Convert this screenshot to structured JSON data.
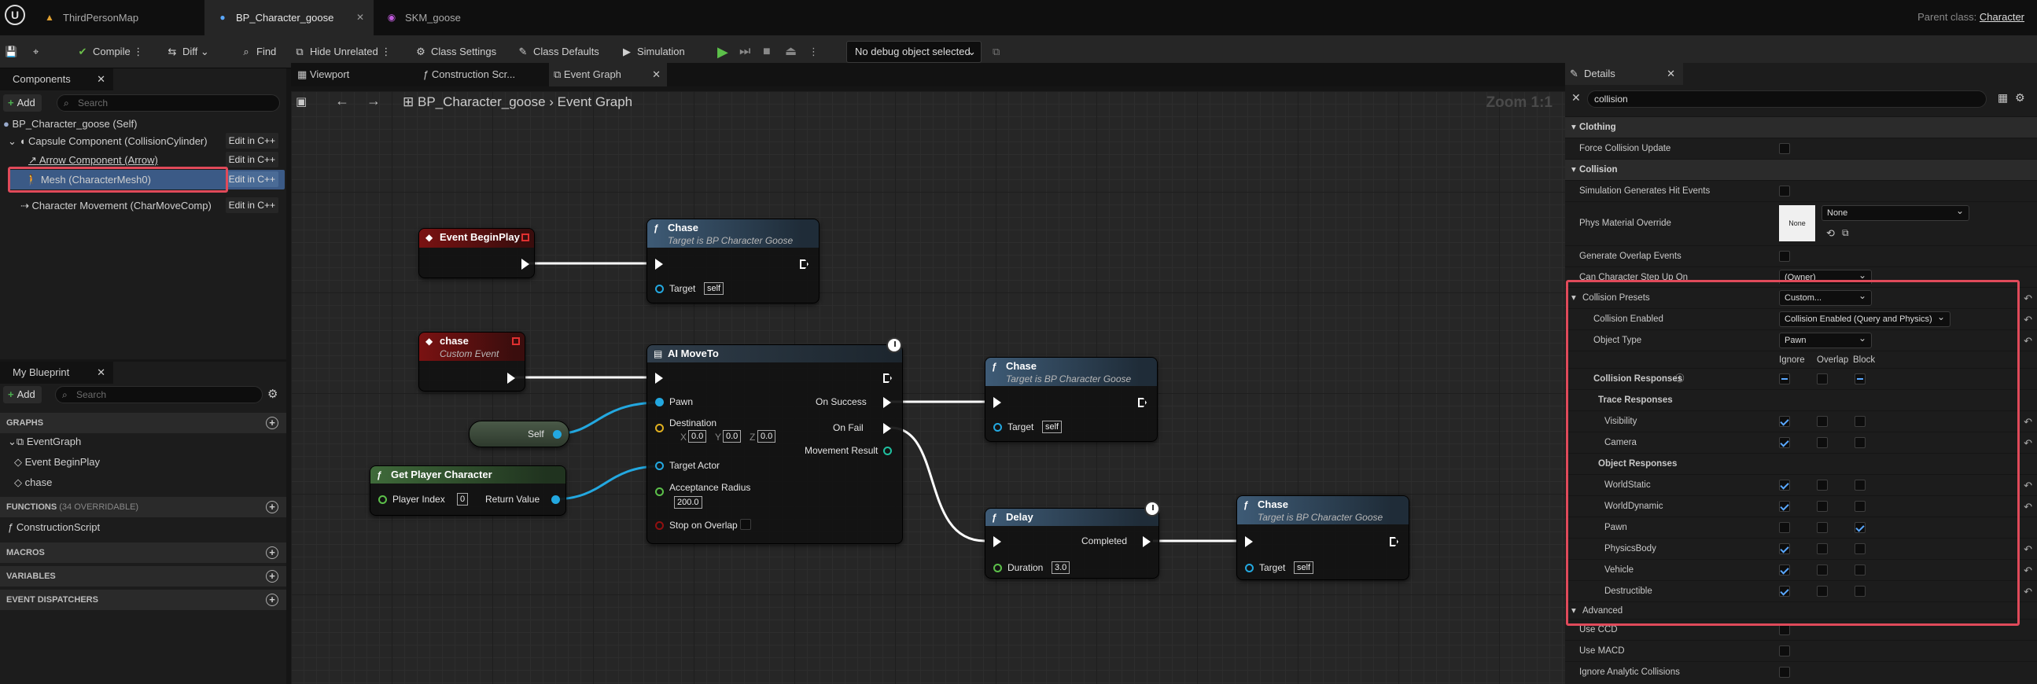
{
  "tabs": [
    {
      "label": "ThirdPersonMap"
    },
    {
      "label": "BP_Character_goose"
    },
    {
      "label": "SKM_goose"
    }
  ],
  "parent": {
    "label": "Parent class:",
    "value": "Character"
  },
  "toolbar": {
    "compile": "Compile",
    "diff": "Diff",
    "find": "Find",
    "hide_unrelated": "Hide Unrelated",
    "class_settings": "Class Settings",
    "class_defaults": "Class Defaults",
    "simulation": "Simulation",
    "debug": "No debug object selected"
  },
  "components": {
    "title": "Components",
    "add": "Add",
    "search": "Search",
    "items": [
      {
        "label": "BP_Character_goose (Self)"
      },
      {
        "label": "Capsule Component (CollisionCylinder)",
        "edit": "Edit in C++"
      },
      {
        "label": "Arrow Component (Arrow)",
        "edit": "Edit in C++"
      },
      {
        "label": "Mesh (CharacterMesh0)",
        "edit": "Edit in C++"
      },
      {
        "label": "Character Movement (CharMoveComp)",
        "edit": "Edit in C++"
      }
    ]
  },
  "myblueprint": {
    "title": "My Blueprint",
    "add": "Add",
    "search": "Search",
    "graphs": "GRAPHS",
    "graph_items": [
      "EventGraph",
      "Event BeginPlay",
      "chase"
    ],
    "functions": "FUNCTIONS",
    "functions_count": "(34 OVERRIDABLE)",
    "function_items": [
      "ConstructionScript"
    ],
    "macros": "MACROS",
    "variables": "VARIABLES",
    "dispatchers": "EVENT DISPATCHERS"
  },
  "graphtabs": [
    {
      "label": "Viewport"
    },
    {
      "label": "Construction Scr..."
    },
    {
      "label": "Event Graph"
    }
  ],
  "breadcrumb": {
    "root": "BP_Character_goose",
    "sep": "›",
    "page": "Event Graph",
    "zoom": "Zoom 1:1"
  },
  "nodes": {
    "beginplay": {
      "title": "Event BeginPlay"
    },
    "chase1": {
      "title": "Chase",
      "subtitle": "Target is BP Character Goose",
      "target": "Target",
      "self": "self"
    },
    "chaseevt": {
      "title": "chase",
      "subtitle": "Custom Event"
    },
    "self": {
      "label": "Self"
    },
    "gpc": {
      "title": "Get Player Character",
      "index_label": "Player Index",
      "index": "0",
      "ret": "Return Value"
    },
    "aimove": {
      "title": "AI MoveTo",
      "pawn": "Pawn",
      "dest": "Destination",
      "x": "0.0",
      "y": "0.0",
      "z": "0.0",
      "target_actor": "Target Actor",
      "accept": "Acceptance Radius",
      "accept_val": "200.0",
      "stop": "Stop on Overlap",
      "on_success": "On Success",
      "on_fail": "On Fail",
      "move_result": "Movement Result",
      "xl": "X",
      "yl": "Y",
      "zl": "Z"
    },
    "chase2": {
      "title": "Chase",
      "subtitle": "Target is BP Character Goose",
      "target": "Target",
      "self": "self"
    },
    "delay": {
      "title": "Delay",
      "duration": "Duration",
      "duration_val": "3.0",
      "completed": "Completed"
    },
    "chase3": {
      "title": "Chase",
      "subtitle": "Target is BP Character Goose",
      "target": "Target",
      "self": "self"
    }
  },
  "details": {
    "title": "Details",
    "search": "collision",
    "rows": {
      "clothing": "Clothing",
      "force_update": "Force Collision Update",
      "collision": "Collision",
      "sim_hit": "Simulation Generates Hit Events",
      "phys_mat": "Phys Material Override",
      "phys_none": "None",
      "phys_dd": "None",
      "gen_overlap": "Generate Overlap Events",
      "step_up": "Can Character Step Up On",
      "step_up_val": "(Owner)",
      "presets": "Collision Presets",
      "presets_val": "Custom...",
      "enabled": "Collision Enabled",
      "enabled_val": "Collision Enabled (Query and Physics)",
      "obj_type": "Object Type",
      "obj_type_val": "Pawn",
      "ignore": "Ignore",
      "overlap": "Overlap",
      "block": "Block",
      "responses": "Collision Responses",
      "trace": "Trace Responses",
      "visibility": "Visibility",
      "camera": "Camera",
      "objresp": "Object Responses",
      "worldstatic": "WorldStatic",
      "worlddynamic": "WorldDynamic",
      "pawn": "Pawn",
      "physicsbody": "PhysicsBody",
      "vehicle": "Vehicle",
      "destructible": "Destructible",
      "advanced": "Advanced",
      "ccd": "Use CCD",
      "macd": "Use MACD",
      "ignore_analytic": "Ignore Analytic Collisions"
    }
  },
  "colors": {
    "highlight": "#e04a5a",
    "exec": "#ffffff",
    "object_pin": "#23a8e0"
  }
}
